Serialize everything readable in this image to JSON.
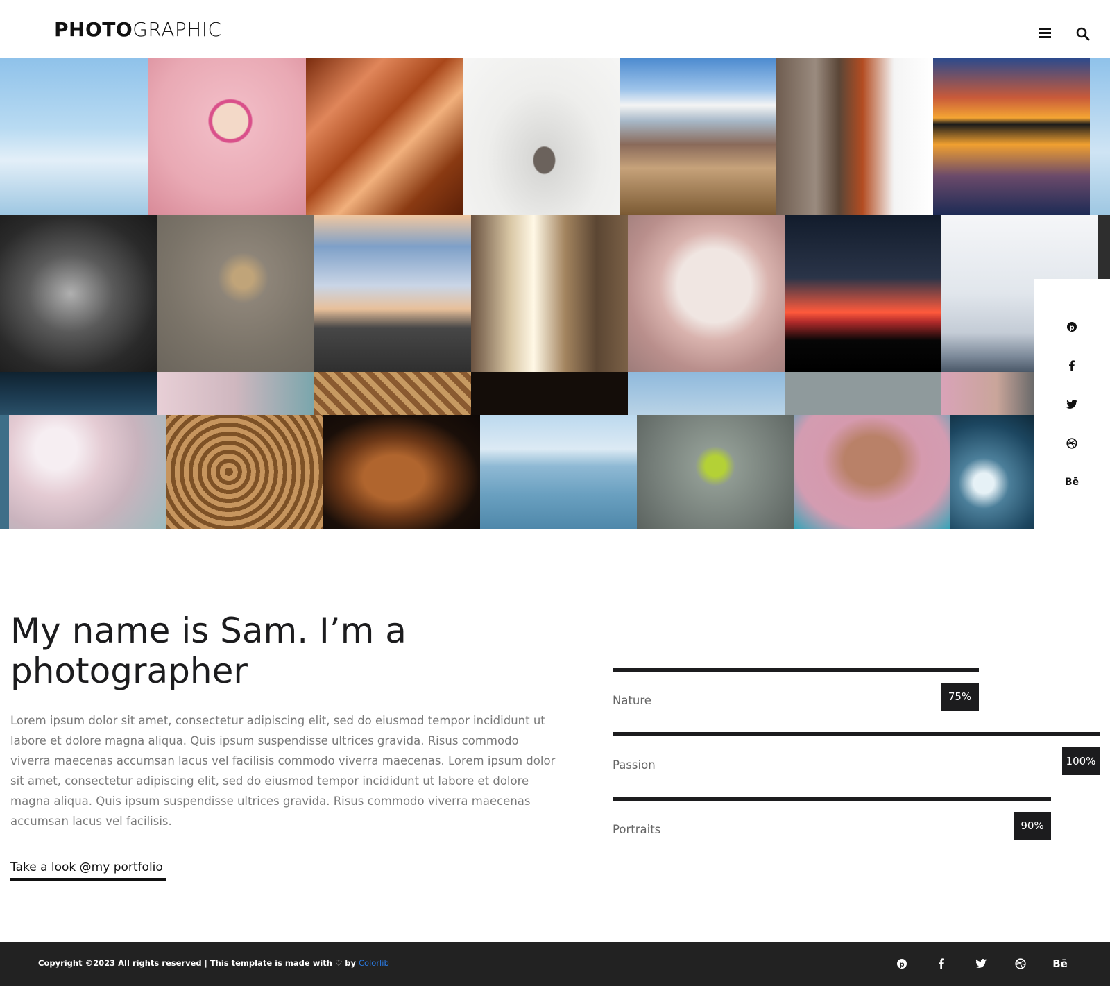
{
  "brand": {
    "bold": "PHOTO",
    "light": "GRAPHIC"
  },
  "header": {
    "menu_icon": "hamburger-icon",
    "search_icon": "search-icon"
  },
  "gallery": {
    "images": [
      "snowy-mountains",
      "pink-flamingo-feathers",
      "antelope-canyon",
      "small-bird-on-snow",
      "desert-mountains",
      "red-panda-on-tree",
      "sunset-yoga-reflection",
      "girl-black-and-white",
      "dragonfly-on-grass",
      "road-above-clouds",
      "street-buildings-vintage-car",
      "flamingo-neck",
      "night-sky-red-horizon",
      "fisherman-in-mist",
      "pink-dandelion-seeds",
      "coiled-rope",
      "brown-dog-profile",
      "sailboat-on-lake",
      "ginkgo-leaf-on-statue",
      "elderly-woman-portrait",
      "ocean-waves"
    ]
  },
  "social": {
    "icons": [
      {
        "name": "pinterest-icon",
        "glyph": "ⓟ"
      },
      {
        "name": "facebook-icon",
        "glyph": "f"
      },
      {
        "name": "twitter-icon",
        "glyph": "🐦"
      },
      {
        "name": "dribbble-icon",
        "glyph": "⊛"
      },
      {
        "name": "behance-icon",
        "glyph": "Bē"
      }
    ]
  },
  "about": {
    "title": "My name is Sam. I’m a photographer",
    "text": "Lorem ipsum dolor sit amet, consectetur adipiscing elit, sed do eiusmod tempor incididunt ut labore et dolore magna aliqua. Quis ipsum suspendisse ultrices gravida. Risus commodo viverra maecenas accumsan lacus vel facilisis commodo viverra maecenas. Lorem ipsum dolor sit amet, consectetur adipiscing elit, sed do eiusmod tempor incididunt ut labore et dolore magna aliqua. Quis ipsum suspendisse ultrices gravida. Risus commodo viverra maecenas accumsan lacus vel facilisis.",
    "link": "Take a look @my portfolio"
  },
  "skills": [
    {
      "label": "Nature",
      "percent_label": "75%",
      "value": 75
    },
    {
      "label": "Passion",
      "percent_label": "100%",
      "value": 100
    },
    {
      "label": "Portraits",
      "percent_label": "90%",
      "value": 90
    }
  ],
  "footer": {
    "copyright": "Copyright ©2023 All rights reserved | This template is made with ♡ by",
    "credit": "Colorlib"
  },
  "colors": {
    "dark": "#1c1c1e",
    "footer_bg": "#222222",
    "link": "#2a7ae2"
  }
}
